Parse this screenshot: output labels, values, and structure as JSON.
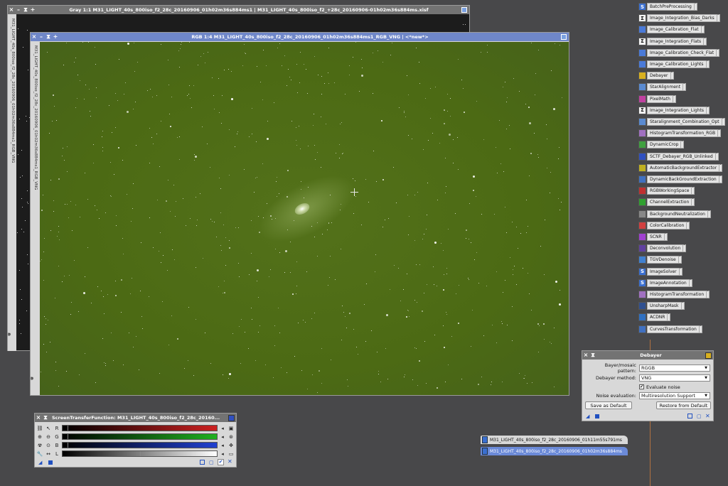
{
  "colors": {
    "desktop": "#48484a",
    "titlebar_active": "#6f87c9",
    "titlebar_inactive": "#737373",
    "image_green": "#4c6a14",
    "stf_red": "#cc2020",
    "stf_green": "#20b020",
    "stf_blue": "#2040d0",
    "tab_active": "#6b8ad8"
  },
  "windows": {
    "gray": {
      "title": "Gray 1:1 M31_LIGHT_40s_800iso_f2_28c_20160906_01h02m36s884ms1 | M31_LIGHT_40s_800iso_f2_+28c_20160906-01h02m36s884ms.xisf",
      "side_label": "M31_LIGHT_40s_800iso_f2_28c_20160906_01h02m36s884ms1_RGB_VNG"
    },
    "rgb": {
      "title": "RGB 1:4 M31_LIGHT_40s_800iso_f2_28c_20160906_01h02m36s884ms1_RGB_VNG | <*new*>",
      "side_label": "M31_LIGHT_40s_800iso_f2_28c_20160906_01h02m36s884ms1_RGB_VNG"
    }
  },
  "process_icons": [
    {
      "label": "BatchPreProcessing",
      "icon": "script-s-icon",
      "color": "#3a6fd0",
      "glyph": "S"
    },
    {
      "label": "Image_Integration_Bias_Darks",
      "icon": "sigma-icon",
      "color": "#f4f4f4",
      "glyph": "Σ"
    },
    {
      "label": "Image_Calibration_Flat",
      "icon": "calibration-icon",
      "color": "#4a7ad8",
      "glyph": ""
    },
    {
      "label": "Image_Integration_Flats",
      "icon": "sigma-icon",
      "color": "#f4f4f4",
      "glyph": "Σ"
    },
    {
      "label": "Image_Calibration_Check_Flat",
      "icon": "calibration-icon",
      "color": "#4a7ad8",
      "glyph": ""
    },
    {
      "label": "Image_Calibration_Lights",
      "icon": "calibration-icon",
      "color": "#4a7ad8",
      "glyph": ""
    },
    {
      "label": "Debayer",
      "icon": "debayer-icon",
      "color": "#d8b020",
      "glyph": ""
    },
    {
      "label": "StarAlignment",
      "icon": "staralignment-icon",
      "color": "#5a8ad0",
      "glyph": ""
    },
    {
      "label": "PixelMath",
      "icon": "pixelmath-icon",
      "color": "#c040a0",
      "glyph": ""
    },
    {
      "label": "Image_Integration_Lights",
      "icon": "sigma-icon",
      "color": "#f4f4f4",
      "glyph": "Σ"
    },
    {
      "label": "Staralignment_Combination_Opt",
      "icon": "staralignment-icon",
      "color": "#5a8ad0",
      "glyph": ""
    },
    {
      "label": "HistogramTransformation_RGB",
      "icon": "histogram-icon",
      "color": "#a070c0",
      "glyph": ""
    },
    {
      "label": "DynamicCrop",
      "icon": "crop-icon",
      "color": "#40a040",
      "glyph": ""
    },
    {
      "label": "SCTF_Debayer_RGB_Unlinked",
      "icon": "stf-icon",
      "color": "#3050c0",
      "glyph": ""
    },
    {
      "label": "AutomaticBackgroundExtractor",
      "icon": "abe-icon",
      "color": "#c0b020",
      "glyph": ""
    },
    {
      "label": "DynamicBackGroundExtraction",
      "icon": "dbe-icon",
      "color": "#4070c0",
      "glyph": ""
    },
    {
      "label": "RGBWorkingSpace",
      "icon": "rgbws-icon",
      "color": "#c03030",
      "glyph": ""
    },
    {
      "label": "ChannelExtraction",
      "icon": "channelextraction-icon",
      "color": "#30a030",
      "glyph": ""
    },
    {
      "label": "BackgroundNeutralization",
      "icon": "backgroundneutralization-icon",
      "color": "#888888",
      "glyph": ""
    },
    {
      "label": "ColorCalibration",
      "icon": "colorcalibration-icon",
      "color": "#d04040",
      "glyph": ""
    },
    {
      "label": "SCNR",
      "icon": "scnr-icon",
      "color": "#a040d0",
      "glyph": ""
    },
    {
      "label": "Deconvolution",
      "icon": "deconvolution-icon",
      "color": "#6040a0",
      "glyph": ""
    },
    {
      "label": "TGVDenoise",
      "icon": "tgvdenoise-icon",
      "color": "#4080d0",
      "glyph": ""
    },
    {
      "label": "ImageSolver",
      "icon": "script-s-icon",
      "color": "#3a6fd0",
      "glyph": "S"
    },
    {
      "label": "ImageAnnotation",
      "icon": "script-s-icon",
      "color": "#3a6fd0",
      "glyph": "S"
    },
    {
      "label": "HistogramTransformation",
      "icon": "histogram-icon",
      "color": "#a070c0",
      "glyph": ""
    },
    {
      "label": "UnsharpMask",
      "icon": "unsharpmask-icon",
      "color": "#305090",
      "glyph": ""
    },
    {
      "label": "ACDNR",
      "icon": "acdnr-icon",
      "color": "#3070c0",
      "glyph": ""
    },
    {
      "label": "CurvesTransformation",
      "icon": "curves-icon",
      "color": "#4070c0",
      "glyph": ""
    }
  ],
  "debayer": {
    "title": "Debayer",
    "pattern_label": "Bayer/mosaic pattern:",
    "pattern_value": "RGGB",
    "method_label": "Debayer method:",
    "method_value": "VNG",
    "evaluate_label": "Evaluate noise",
    "evaluate_checked": true,
    "noise_label": "Noise evaluation:",
    "noise_value": "Multiresolution Support",
    "save_default": "Save as Default",
    "restore_default": "Restore from Default"
  },
  "stf": {
    "title": "ScreenTransferFunction: M31_LIGHT_40s_800iso_f2_28c_20160...",
    "channels": [
      {
        "letter": "R",
        "gradient_end": "#cc2020",
        "marker": 0.03
      },
      {
        "letter": "G",
        "gradient_end": "#20b020",
        "marker": 0.03
      },
      {
        "letter": "B",
        "gradient_end": "#2040d0",
        "marker": 0.03
      },
      {
        "letter": "L",
        "gradient_end": "#ffffff",
        "marker": 0.5
      }
    ]
  },
  "image_tabs": [
    {
      "label": "M31_LIGHT_40s_800iso_f2_28c_20160906_01h11m55s791ms",
      "active": false
    },
    {
      "label": "M31_LIGHT_40s_800iso_f2_28c_20160906_01h02m36s884ms",
      "active": true
    }
  ]
}
